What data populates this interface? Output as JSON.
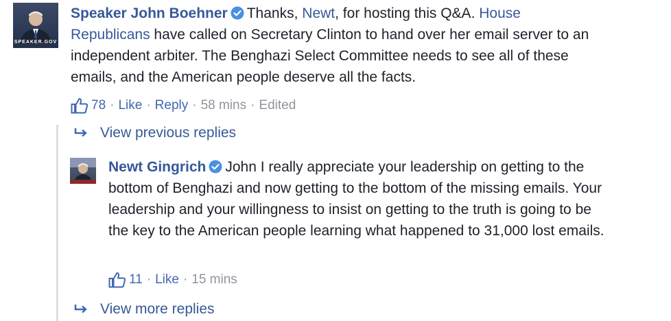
{
  "comment": {
    "author": "Speaker John Boehner",
    "avatar_text": "SPEAKER.GOV",
    "text_1": "Thanks, ",
    "mention_1": "Newt",
    "text_2": ", for hosting this Q&A. ",
    "mention_2": "House Republicans",
    "text_3": " have called on Secretary Clinton to hand over her email server to an independent arbiter. The Benghazi Select Committee needs to see all of these emails, and the American people deserve all the facts.",
    "likes": "78",
    "like_label": "Like",
    "reply_label": "Reply",
    "time": "58 mins",
    "edited": "Edited"
  },
  "view_previous": "View previous replies",
  "reply": {
    "author": "Newt Gingrich",
    "text": "John I really appreciate your leadership on getting to the bottom of Benghazi and now getting to the bottom of the missing emails. Your leadership and your willingness to insist on getting to the truth is going to be the key to the American people learning what happened to 31,000 lost emails.",
    "likes": "11",
    "like_label": "Like",
    "time": "15 mins"
  },
  "view_more": "View more replies",
  "colors": {
    "link": "#365899",
    "meta": "#90949c",
    "like_blue": "#4267b2",
    "verified": "#4a90e2"
  },
  "icons": [
    "verified-badge-icon",
    "thumbs-up-icon",
    "reply-arrow-icon"
  ]
}
